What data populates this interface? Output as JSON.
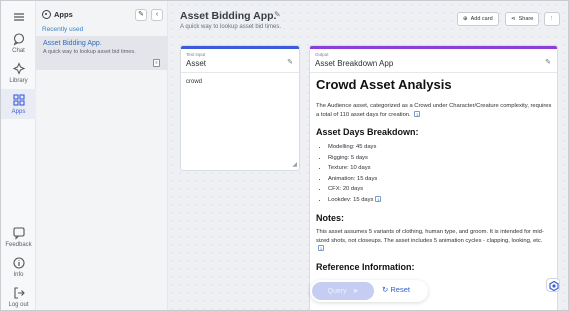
{
  "nav": {
    "items": [
      {
        "label": "Chat",
        "icon": "chat-icon"
      },
      {
        "label": "Library",
        "icon": "library-icon"
      },
      {
        "label": "Apps",
        "icon": "apps-icon"
      },
      {
        "label": "Feedback",
        "icon": "feedback-icon"
      },
      {
        "label": "Info",
        "icon": "info-icon"
      },
      {
        "label": "Log out",
        "icon": "logout-icon"
      }
    ]
  },
  "apps_panel": {
    "title": "Apps",
    "section": "Recently used",
    "item": {
      "title": "Asset Bidding App.",
      "description": "A quick way to lookup asset bid times."
    }
  },
  "header": {
    "title": "Asset Bidding App.",
    "subtitle": "A quick way to lookup asset bid times.",
    "add_card": "Add card",
    "share": "Share"
  },
  "input_card": {
    "label": "Text input",
    "title": "Asset",
    "value": "crowd"
  },
  "output_card": {
    "label": "Output",
    "title": "Asset Breakdown App",
    "heading": "Crowd Asset Analysis",
    "intro": "The Audience asset, categorized as a Crowd under Character/Creature complexity, requires a total of 110 asset days for creation.",
    "breakdown_heading": "Asset Days Breakdown:",
    "breakdown": [
      "Modelling: 45 days",
      "Rigging: 5 days",
      "Texture: 10 days",
      "Animation: 15 days",
      "CFX: 20 days",
      "Lookdev: 15 days"
    ],
    "notes_heading": "Notes:",
    "notes": "This asset assumes 5 variants of clothing, human type, and groom. It is intended for mid-sized shots, not closeups. The asset includes 5 animation cycles - clapping, looking, etc.",
    "reference_heading": "Reference Information:",
    "citation": "1"
  },
  "actions": {
    "query": "Query",
    "reset": "Reset"
  },
  "colors": {
    "accent": "#3b5bdb",
    "input_bar": "#3b5bdb",
    "output_bar": "#8b3fd9"
  }
}
